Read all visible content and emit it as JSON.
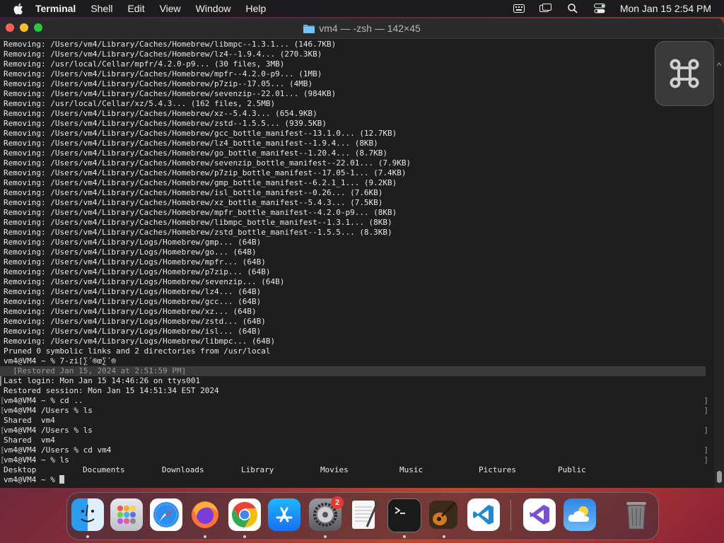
{
  "menubar": {
    "app": "Terminal",
    "items": [
      "Shell",
      "Edit",
      "View",
      "Window",
      "Help"
    ],
    "datetime": "Mon Jan 15  2:54 PM"
  },
  "window": {
    "title": "vm4 — -zsh — 142×45"
  },
  "terminal": {
    "output": [
      "Removing: /Users/vm4/Library/Caches/Homebrew/libmpc--1.3.1... (146.7KB)",
      "Removing: /Users/vm4/Library/Caches/Homebrew/lz4--1.9.4... (270.3KB)",
      "Removing: /usr/local/Cellar/mpfr/4.2.0-p9... (30 files, 3MB)",
      "Removing: /Users/vm4/Library/Caches/Homebrew/mpfr--4.2.0-p9... (1MB)",
      "Removing: /Users/vm4/Library/Caches/Homebrew/p7zip--17.05... (4MB)",
      "Removing: /Users/vm4/Library/Caches/Homebrew/sevenzip--22.01... (984KB)",
      "Removing: /usr/local/Cellar/xz/5.4.3... (162 files, 2.5MB)",
      "Removing: /Users/vm4/Library/Caches/Homebrew/xz--5.4.3... (654.9KB)",
      "Removing: /Users/vm4/Library/Caches/Homebrew/zstd--1.5.5... (939.5KB)",
      "Removing: /Users/vm4/Library/Caches/Homebrew/gcc_bottle_manifest--13.1.0... (12.7KB)",
      "Removing: /Users/vm4/Library/Caches/Homebrew/lz4_bottle_manifest--1.9.4... (8KB)",
      "Removing: /Users/vm4/Library/Caches/Homebrew/go_bottle_manifest--1.20.4... (8.7KB)",
      "Removing: /Users/vm4/Library/Caches/Homebrew/sevenzip_bottle_manifest--22.01... (7.9KB)",
      "Removing: /Users/vm4/Library/Caches/Homebrew/p7zip_bottle_manifest--17.05-1... (7.4KB)",
      "Removing: /Users/vm4/Library/Caches/Homebrew/gmp_bottle_manifest--6.2.1_1... (9.2KB)",
      "Removing: /Users/vm4/Library/Caches/Homebrew/isl_bottle_manifest--0.26... (7.6KB)",
      "Removing: /Users/vm4/Library/Caches/Homebrew/xz_bottle_manifest--5.4.3... (7.5KB)",
      "Removing: /Users/vm4/Library/Caches/Homebrew/mpfr_bottle_manifest--4.2.0-p9... (8KB)",
      "Removing: /Users/vm4/Library/Caches/Homebrew/libmpc_bottle_manifest--1.3.1... (8KB)",
      "Removing: /Users/vm4/Library/Caches/Homebrew/zstd_bottle_manifest--1.5.5... (8.3KB)",
      "Removing: /Users/vm4/Library/Logs/Homebrew/gmp... (64B)",
      "Removing: /Users/vm4/Library/Logs/Homebrew/go... (64B)",
      "Removing: /Users/vm4/Library/Logs/Homebrew/mpfr... (64B)",
      "Removing: /Users/vm4/Library/Logs/Homebrew/p7zip... (64B)",
      "Removing: /Users/vm4/Library/Logs/Homebrew/sevenzip... (64B)",
      "Removing: /Users/vm4/Library/Logs/Homebrew/lz4... (64B)",
      "Removing: /Users/vm4/Library/Logs/Homebrew/gcc... (64B)",
      "Removing: /Users/vm4/Library/Logs/Homebrew/xz... (64B)",
      "Removing: /Users/vm4/Library/Logs/Homebrew/zstd... (64B)",
      "Removing: /Users/vm4/Library/Logs/Homebrew/isl... (64B)",
      "Removing: /Users/vm4/Library/Logs/Homebrew/libmpc... (64B)",
      "Pruned 0 symbolic links and 2 directories from /usr/local",
      "vm4@VM4 ~ % 7-zi[∑´®œ∑´®"
    ],
    "restored_banner": "  [Restored Jan 15, 2024 at 2:51:59 PM]",
    "last_login": "Last login: Mon Jan 15 14:46:26 on ttys001",
    "restored_session": "Restored session: Mon Jan 15 14:51:34 EST 2024",
    "session": [
      {
        "text": "vm4@VM4 ~ % cd ..",
        "marked": true
      },
      {
        "text": "vm4@VM4 /Users % ls",
        "marked": true
      },
      {
        "text": "Shared  vm4",
        "marked": false
      },
      {
        "text": "vm4@VM4 /Users % ls",
        "marked": true
      },
      {
        "text": "Shared  vm4",
        "marked": false
      },
      {
        "text": "vm4@VM4 /Users % cd vm4",
        "marked": true
      },
      {
        "text": "vm4@VM4 ~ % ls",
        "marked": true
      }
    ],
    "ls_entries": [
      "Desktop",
      "Documents",
      "Downloads",
      "Library",
      "Movies",
      "Music",
      "Pictures",
      "Public"
    ],
    "prompt": "vm4@VM4 ~ % "
  },
  "dock": {
    "apps": [
      "Finder",
      "Launchpad",
      "Safari",
      "Firefox",
      "Google Chrome",
      "App Store",
      "System Settings",
      "TextEdit",
      "Terminal",
      "Instruments",
      "Visual Studio Code",
      "Visual Studio",
      "Weather",
      "Trash"
    ],
    "settings_badge": "2"
  },
  "colors": {
    "terminal_bg": "#1e1e1e",
    "terminal_text": "#e8e8e8",
    "close": "#ff5f57",
    "minimize": "#febc2e",
    "zoom": "#28c840"
  }
}
